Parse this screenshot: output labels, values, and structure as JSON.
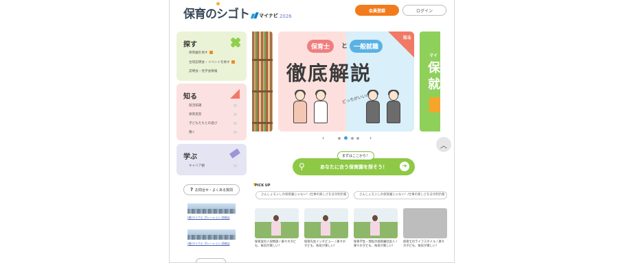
{
  "header": {
    "logo_main": "保育のシゴト",
    "logo_sub": "マイナビ",
    "logo_year": "2026",
    "register_label": "会員登録",
    "login_label": "ログイン"
  },
  "sidebar": {
    "sagasu": {
      "title": "探す",
      "items": [
        "保育園を探す",
        "合同説明会・イベントを探す",
        "説明会・見学会情報"
      ]
    },
    "shiru": {
      "title": "知る",
      "items": [
        "就活知識",
        "保育実習",
        "子どもたちとの遊び",
        "働く"
      ]
    },
    "manabu": {
      "title": "学ぶ",
      "items": [
        "キャリア観"
      ]
    },
    "faq_label": "お問合せ・よくある質問",
    "links": [
      "(株)マイナビ ポレーション 詳細は",
      "(株)マイナビ ポレーション 詳細は"
    ]
  },
  "hero": {
    "pill_left": "保育士",
    "pill_to": "と",
    "pill_right": "一般就職",
    "big_text": "徹底解説",
    "sub_text": "どっちがいいの？",
    "flag_text": "知る",
    "right_peek_label": "マイ",
    "right_peek_big": "保就"
  },
  "carousel": {
    "prev": "‹",
    "next": "›",
    "slide_count": 4,
    "active_index": 1,
    "to_top": "︿"
  },
  "cta": {
    "label": "まずはここから！",
    "text": "あなたに合う保育園を探そう！",
    "arrow": "➜"
  },
  "pickup": {
    "title": "PICK UP",
    "tags": [
      "さんしょモミしの保育園じゃない！/仕事の楽しさを法令明示集",
      "さんしょモミしの保育園じゃない！/仕事の楽しさを法令明示集"
    ],
    "articles": [
      "保育実の人形物語 / 楽々ホタビも、毎日が楽しい！",
      "保育先生インタビュー / 楽々ホタビも、毎日が楽しい！",
      "保育学生・現役の保育園社会人 / 楽々ホタビも、毎日が楽しい！",
      "保育士のライフスタイル / 楽々ホタビも、毎日が楽しい！"
    ]
  },
  "colors": {
    "accent_orange": "#f27b1c",
    "cta_green": "#8ec945",
    "card_green": "#eaf3d6",
    "card_pink": "#fbe1e1",
    "card_purple": "#e5e4f3"
  }
}
